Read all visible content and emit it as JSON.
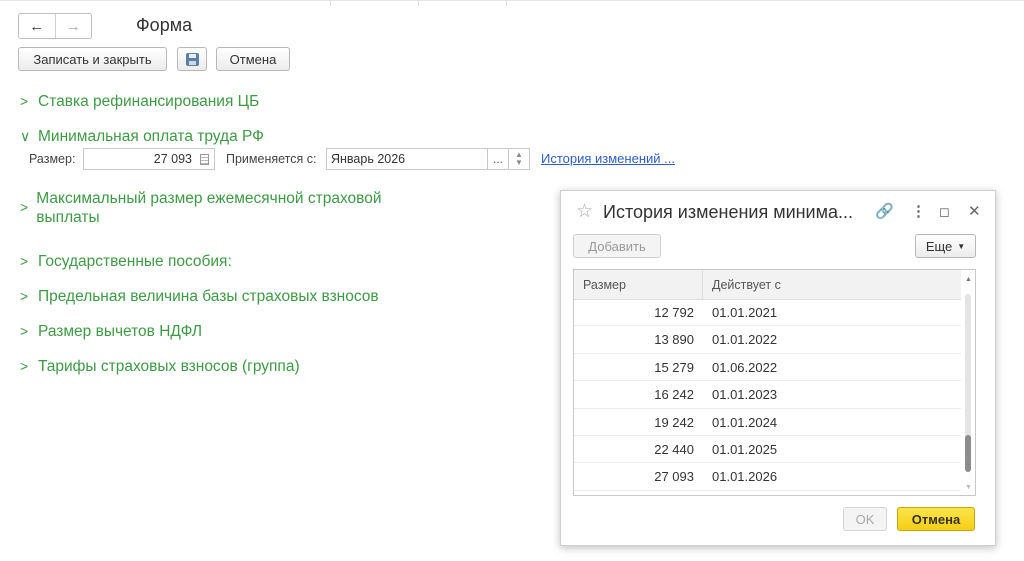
{
  "form": {
    "title": "Форма",
    "back_label": "←",
    "forward_label": "→"
  },
  "toolbar": {
    "save_close_label": "Записать и закрыть",
    "cancel_label": "Отмена"
  },
  "groups": [
    {
      "label": "Ставка рефинансирования ЦБ",
      "expanded": false
    },
    {
      "label": "Минимальная оплата труда РФ",
      "expanded": true
    },
    {
      "label": "Максимальный размер ежемесячной страховой выплаты",
      "expanded": false
    },
    {
      "label": "Государственные пособия:",
      "expanded": false
    },
    {
      "label": "Предельная величина базы страховых взносов",
      "expanded": false
    },
    {
      "label": "Размер вычетов НДФЛ",
      "expanded": false
    },
    {
      "label": "Тарифы страховых взносов (группа)",
      "expanded": false
    }
  ],
  "mrot": {
    "size_label": "Размер:",
    "size_value": "27 093",
    "applies_label": "Применяется с:",
    "applies_value": "Январь 2026",
    "dots": "...",
    "history_link": "История изменений ..."
  },
  "dialog": {
    "title": "История изменения минима...",
    "add_label": "Добавить",
    "more_label": "Еще",
    "columns": [
      "Размер",
      "Действует с"
    ],
    "rows": [
      {
        "size": "12 792",
        "date": "01.01.2021"
      },
      {
        "size": "13 890",
        "date": "01.01.2022"
      },
      {
        "size": "15 279",
        "date": "01.06.2022"
      },
      {
        "size": "16 242",
        "date": "01.01.2023"
      },
      {
        "size": "19 242",
        "date": "01.01.2024"
      },
      {
        "size": "22 440",
        "date": "01.01.2025"
      },
      {
        "size": "27 093",
        "date": "01.01.2026"
      }
    ],
    "ok_label": "OK",
    "cancel_label": "Отмена"
  },
  "colors": {
    "group_green": "#3e9a45",
    "link_blue": "#2d5ec4",
    "accent_yellow": "#f5cf15"
  }
}
